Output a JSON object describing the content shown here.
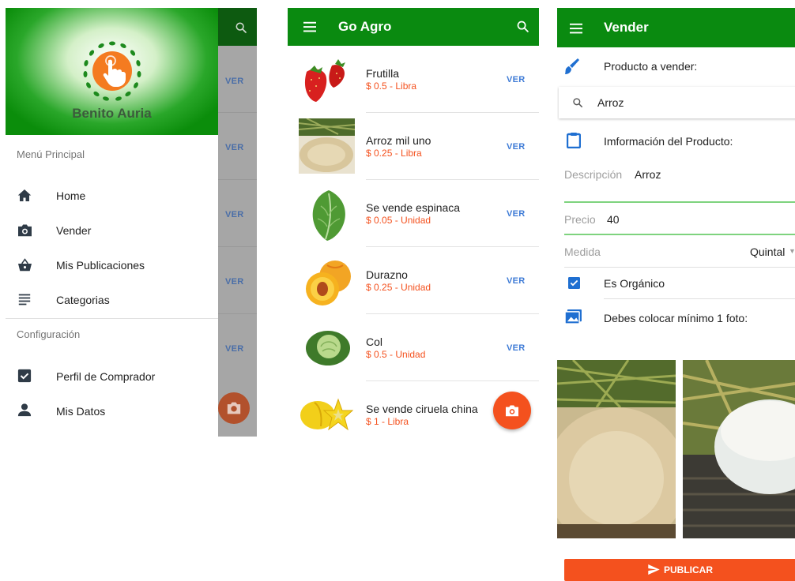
{
  "drawer_screen": {
    "user_name": "Benito Auria",
    "section_main": "Menú Principal",
    "menu_items": [
      {
        "label": "Home",
        "icon": "home-icon"
      },
      {
        "label": "Vender",
        "icon": "camera-icon"
      },
      {
        "label": "Mis Publicaciones",
        "icon": "basket-icon"
      },
      {
        "label": "Categorias",
        "icon": "list-icon"
      }
    ],
    "section_config": "Configuración",
    "config_items": [
      {
        "label": "Perfil de Comprador",
        "icon": "checkbox-icon"
      },
      {
        "label": "Mis Datos",
        "icon": "person-icon"
      }
    ],
    "behind_ver": [
      "VER",
      "VER",
      "VER",
      "VER",
      "VER"
    ]
  },
  "list_screen": {
    "app_title": "Go Agro",
    "items": [
      {
        "title": "Frutilla",
        "price": "$ 0.5 - Libra",
        "action": "VER"
      },
      {
        "title": "Arroz mil uno",
        "price": "$ 0.25 - Libra",
        "action": "VER"
      },
      {
        "title": "Se vende espinaca",
        "price": "$ 0.05 - Unidad",
        "action": "VER"
      },
      {
        "title": "Durazno",
        "price": "$ 0.25 - Unidad",
        "action": "VER"
      },
      {
        "title": "Col",
        "price": "$ 0.5 - Unidad",
        "action": "VER"
      },
      {
        "title": "Se vende ciruela china",
        "price": "$ 1 - Libra",
        "action": ""
      }
    ]
  },
  "sell_screen": {
    "title": "Vender",
    "product_to_sell_label": "Producto a vender:",
    "search_value": "Arroz",
    "product_info_label": "Imformación del Producto:",
    "description_label": "Descripción",
    "description_value": "Arroz",
    "price_label": "Precio",
    "price_value": "40",
    "measure_label": "Medida",
    "measure_value": "Quintal",
    "organic_label": "Es Orgánico",
    "organic_checked": true,
    "photo_label": "Debes colocar mínimo 1 foto:",
    "publish_label": "PUBLICAR"
  },
  "colors": {
    "primary_green": "#0a8a10",
    "accent_orange": "#f4511e",
    "link_blue": "#3e7bd6"
  }
}
